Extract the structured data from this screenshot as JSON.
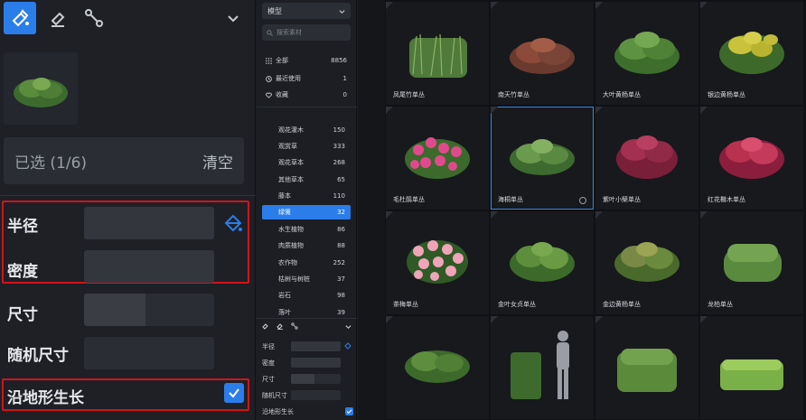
{
  "left_panel": {
    "selected_label": "已选 (1/6)",
    "clear_label": "清空",
    "radius_label": "半径",
    "density_label": "密度",
    "size_label": "尺寸",
    "random_size_label": "随机尺寸",
    "follow_terrain_label": "沿地形生长",
    "follow_terrain_checked": true
  },
  "middle_panel": {
    "dropdown_value": "模型",
    "search_placeholder": "搜索素材",
    "quick": [
      {
        "label": "全部",
        "count": "8856"
      },
      {
        "label": "最近使用",
        "count": "1"
      },
      {
        "label": "收藏",
        "count": "0"
      }
    ],
    "categories": [
      {
        "label": "观花灌木",
        "count": "150"
      },
      {
        "label": "观赏草",
        "count": "333"
      },
      {
        "label": "观花草本",
        "count": "268"
      },
      {
        "label": "其他草本",
        "count": "65"
      },
      {
        "label": "藤本",
        "count": "110"
      },
      {
        "label": "绿篱",
        "count": "32",
        "active": true
      },
      {
        "label": "水生植物",
        "count": "86"
      },
      {
        "label": "肉质植物",
        "count": "88"
      },
      {
        "label": "农作物",
        "count": "252"
      },
      {
        "label": "枯树与树桩",
        "count": "37"
      },
      {
        "label": "岩石",
        "count": "98"
      },
      {
        "label": "落叶",
        "count": "39"
      }
    ],
    "props": {
      "radius_label": "半径",
      "density_label": "密度",
      "size_label": "尺寸",
      "random_size_label": "随机尺寸",
      "follow_terrain_label": "沿地形生长"
    }
  },
  "grid": {
    "items": [
      {
        "name": "凤尾竹单丛"
      },
      {
        "name": "南天竹单丛"
      },
      {
        "name": "大叶黄杨单丛"
      },
      {
        "name": "银边黄杨单丛"
      },
      {
        "name": "毛杜鹃单丛"
      },
      {
        "name": "海桐单丛",
        "selected": true
      },
      {
        "name": "紫叶小檗单丛"
      },
      {
        "name": "红花檵木单丛"
      },
      {
        "name": "茶梅单丛"
      },
      {
        "name": "金叶女贞单丛"
      },
      {
        "name": "金边黄杨单丛"
      },
      {
        "name": "龙柏单丛"
      },
      {
        "name": ""
      },
      {
        "name": ""
      },
      {
        "name": ""
      },
      {
        "name": ""
      }
    ]
  },
  "colors": {
    "accent": "#2b7de9",
    "highlight_box": "#d0141b",
    "background": "#1b1d22"
  }
}
